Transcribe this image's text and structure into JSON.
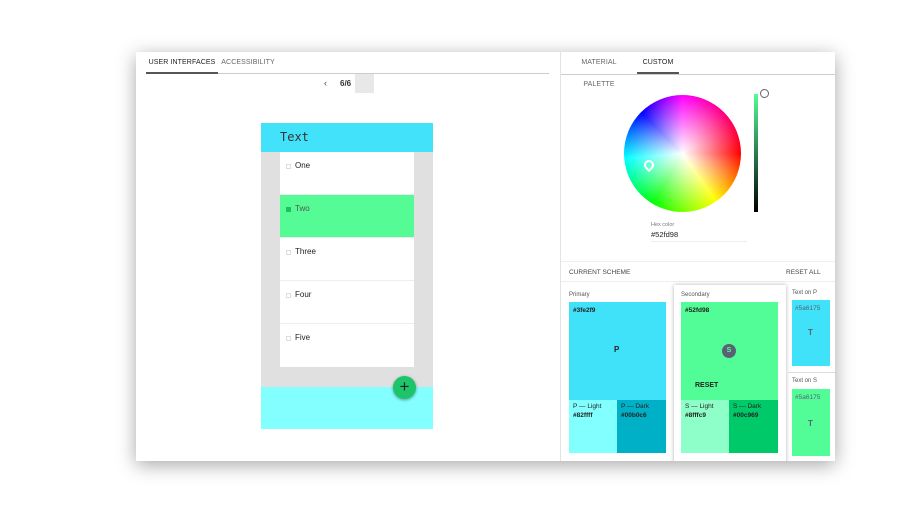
{
  "left_tabs": [
    {
      "label": "USER INTERFACES",
      "active": true
    },
    {
      "label": "ACCESSIBILITY",
      "active": false
    }
  ],
  "pager": {
    "label": "6/6",
    "prev_icon": "chevron-left-icon"
  },
  "phone": {
    "title": "Text",
    "items": [
      "One",
      "Two",
      "Three",
      "Four",
      "Five"
    ],
    "selected_index": 1,
    "fab_icon": "plus-icon"
  },
  "right_tabs": [
    {
      "label": "MATERIAL PALETTE",
      "active": false
    },
    {
      "label": "CUSTOM",
      "active": true
    }
  ],
  "picker": {
    "hex_label": "Hex color",
    "hex_value": "#52fd98"
  },
  "scheme": {
    "title": "CURRENT SCHEME",
    "reset_all": "RESET ALL",
    "primary": {
      "label": "Primary",
      "hex": "#3fe2f9",
      "letter": "P",
      "light_label": "P — Light",
      "light_hex": "#82ffff",
      "dark_label": "P — Dark",
      "dark_hex": "#00b0c6"
    },
    "secondary": {
      "label": "Secondary",
      "hex": "#52fd98",
      "letter": "S",
      "reset": "RESET",
      "light_label": "S — Light",
      "light_hex": "#8fffc9",
      "dark_label": "S — Dark",
      "dark_hex": "#00c969"
    },
    "text_on_p": {
      "label": "Text on P",
      "hex": "#5a6175",
      "letter": "T"
    },
    "text_on_s": {
      "label": "Text on S",
      "hex": "#5a6175",
      "letter": "T"
    }
  }
}
